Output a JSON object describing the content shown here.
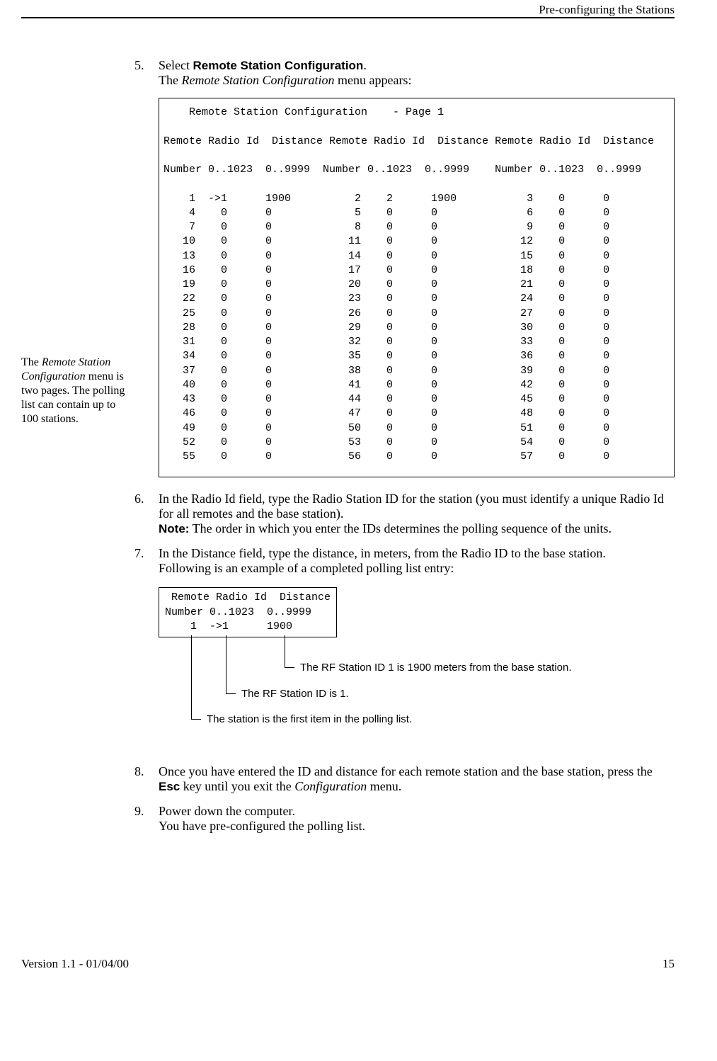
{
  "header": {
    "right": "Pre-configuring the Stations"
  },
  "steps": {
    "s5": {
      "num": "5.",
      "lead": "Select ",
      "bold": "Remote Station Configuration",
      "tail": ".",
      "line2a": "The ",
      "line2i": "Remote Station Configuration",
      "line2b": " menu appears:"
    },
    "s6": {
      "num": "6.",
      "p1": "In the Radio Id field, type the Radio Station ID for the station (you must identify a unique Radio Id for all remotes and the base station).",
      "noteLabel": "Note:",
      "noteText": " The order in which you enter the IDs determines the polling sequence of the units."
    },
    "s7": {
      "num": "7.",
      "p1": "In the Distance field, type the distance, in meters, from the Radio ID to the base station.",
      "p2": "Following is an example of a completed polling list entry:"
    },
    "s8": {
      "num": "8.",
      "p1a": "Once you have entered the ID and distance for each remote station and the base station, press the ",
      "p1b": "Esc",
      "p1c": " key until you exit the ",
      "p1d": "Configuration",
      "p1e": " menu."
    },
    "s9": {
      "num": "9.",
      "p1": "Power down the computer.",
      "p2": "You have pre-configured the polling list."
    }
  },
  "marginNote": {
    "t1": "The ",
    "t2": "Remote Station Configuration",
    "t3": " menu is two pages. The polling list can contain up to 100 stations."
  },
  "terminal": {
    "title": "    Remote Station Configuration    - Page 1",
    "blank": "",
    "hdr1": "Remote Radio Id  Distance Remote Radio Id  Distance Remote Radio Id  Distance",
    "hdr2": "Number 0..1023  0..9999  Number 0..1023  0..9999    Number 0..1023  0..9999",
    "rows": [
      "    1  ->1      1900          2    2      1900           3    0      0",
      "    4    0      0             5    0      0              6    0      0",
      "    7    0      0             8    0      0              9    0      0",
      "   10    0      0            11    0      0             12    0      0",
      "   13    0      0            14    0      0             15    0      0",
      "   16    0      0            17    0      0             18    0      0",
      "   19    0      0            20    0      0             21    0      0",
      "   22    0      0            23    0      0             24    0      0",
      "   25    0      0            26    0      0             27    0      0",
      "   28    0      0            29    0      0             30    0      0",
      "   31    0      0            32    0      0             33    0      0",
      "   34    0      0            35    0      0             36    0      0",
      "   37    0      0            38    0      0             39    0      0",
      "   40    0      0            41    0      0             42    0      0",
      "   43    0      0            44    0      0             45    0      0",
      "   46    0      0            47    0      0             48    0      0",
      "   49    0      0            50    0      0             51    0      0",
      "   52    0      0            53    0      0             54    0      0",
      "   55    0      0            56    0      0             57    0      0"
    ]
  },
  "example": {
    "l1": " Remote Radio Id  Distance",
    "l2": "Number 0..1023  0..9999",
    "l3": "    1  ->1      1900"
  },
  "callouts": {
    "c1": "The RF Station ID 1 is 1900 meters from the base station.",
    "c2": "The RF Station ID is 1.",
    "c3": "The station is the first item in the polling list."
  },
  "footer": {
    "left": "Version 1.1 - 01/04/00",
    "right": "15"
  }
}
